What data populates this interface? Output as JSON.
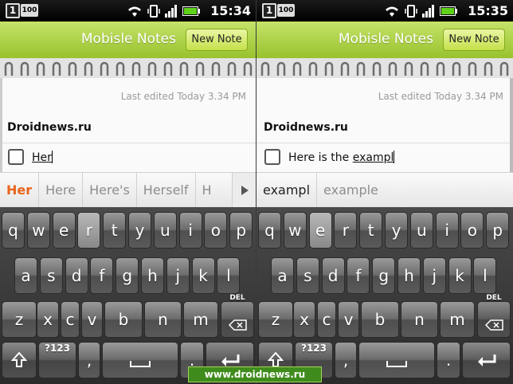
{
  "status_bar": {
    "notification_count": "1",
    "badge": "100",
    "left_time": "15:34",
    "right_time": "15:35"
  },
  "app": {
    "title": "Mobisle Notes",
    "new_note_label": "New Note",
    "accent_color": "#98c22d"
  },
  "note": {
    "last_edited": "Last edited Today 3.34 PM",
    "title": "Droidnews.ru"
  },
  "left": {
    "line_prefix": "",
    "line_word": "Her",
    "suggestions": [
      "Her",
      "Here",
      "Here's",
      "Herself",
      "H"
    ]
  },
  "right": {
    "line_prefix": "Here is the ",
    "line_word": "exampl",
    "suggestions": [
      "exampl",
      "example"
    ]
  },
  "keyboard": {
    "row1": [
      "q",
      "w",
      "e",
      "r",
      "t",
      "y",
      "u",
      "i",
      "o",
      "p"
    ],
    "row2": [
      "a",
      "s",
      "d",
      "f",
      "g",
      "h",
      "j",
      "k",
      "l"
    ],
    "row3": [
      "z",
      "x",
      "c",
      "v",
      "b",
      "n",
      "m"
    ],
    "del": "DEL",
    "sym": "?123",
    "comma": ",",
    "period": "."
  },
  "watermark": "www.droidnews.ru"
}
